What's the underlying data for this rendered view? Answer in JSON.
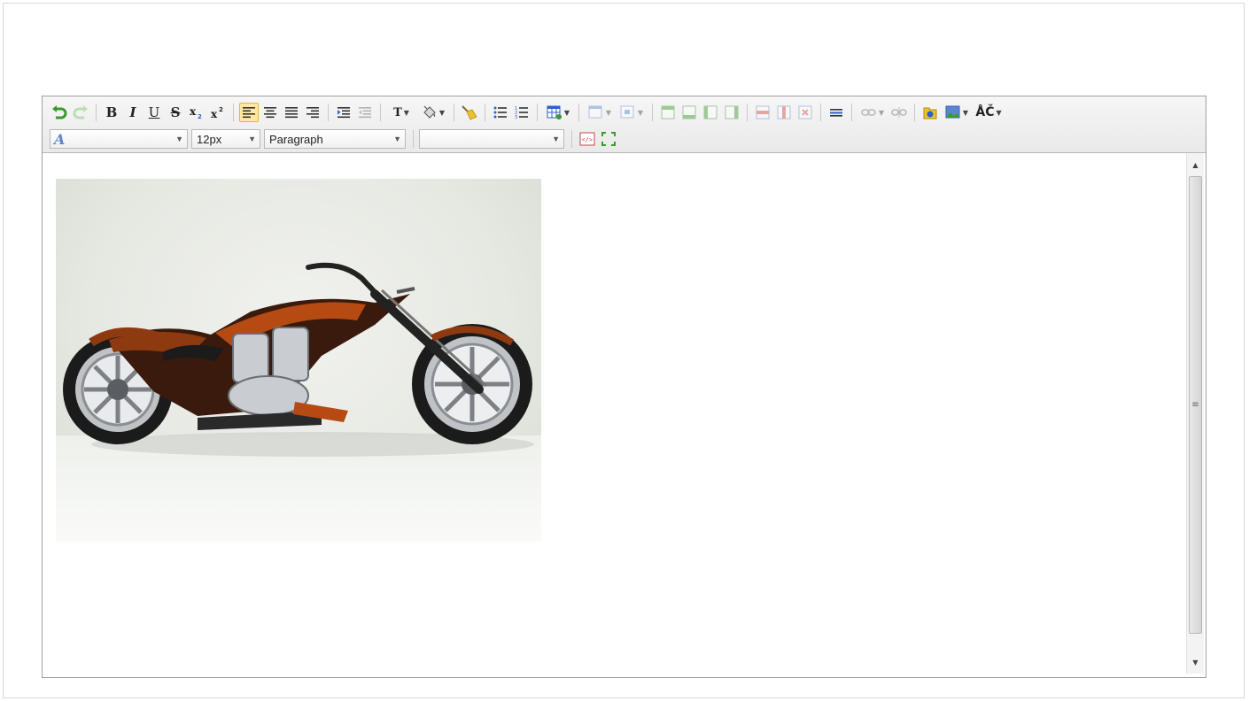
{
  "toolbar": {
    "font_family_value": "",
    "font_size_value": "12px",
    "block_format_value": "Paragraph",
    "style_value": ""
  },
  "content": {
    "image_subject": "motorcycle"
  },
  "scrollbar": {
    "grip": "≡"
  },
  "icons": {
    "undo": "undo-icon",
    "redo": "redo-icon",
    "bold": "B",
    "italic": "I",
    "underline": "U",
    "strikethrough": "S",
    "subscript": "x2",
    "superscript": "x2",
    "text_color": "T",
    "spellcheck": "ÅČ"
  },
  "colors": {
    "accent_active_bg": "#ffe7a3",
    "undo_green": "#3a9a2a",
    "toolbar_bg": "#eeeeee"
  }
}
